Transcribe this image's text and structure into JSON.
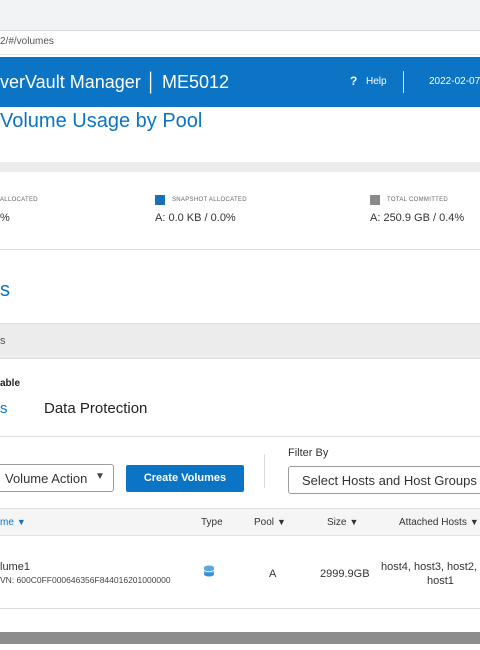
{
  "browser": {
    "url": "2/#/volumes"
  },
  "header": {
    "title": "verVault Manager │ ME5012",
    "help_glyph": "?",
    "help_label": "Help",
    "date": "2022-02-07"
  },
  "page_title": " Volume Usage by Pool",
  "stats": [
    {
      "label": "ALLOCATED",
      "value": "%",
      "color": ""
    },
    {
      "label": "SNAPSHOT ALLOCATED",
      "value": "A: 0.0 KB / 0.0%",
      "color": "#1a6fb8"
    },
    {
      "label": "TOTAL COMMITTED",
      "value": "A: 250.9 GB / 0.4%",
      "color": "#8a8a8a"
    }
  ],
  "section_title": "s",
  "table": {
    "label": "able",
    "tabs": [
      "s",
      "Data Protection"
    ]
  },
  "toolbar": {
    "action_label": "Volume Action",
    "create_label": "Create Volumes",
    "filter_by_label": "Filter By",
    "filter_placeholder": "Select Hosts and Host Groups"
  },
  "columns": {
    "name": "me",
    "type": "Type",
    "pool": "Pool",
    "size": "Size",
    "hosts": "Attached Hosts"
  },
  "rows": [
    {
      "name": "lume1",
      "wwn": "VN: 600C0FF000646356F844016201000000",
      "type_icon": "database-icon",
      "pool": "A",
      "size": "2999.9GB",
      "hosts_line1": "host4, host3, host2,",
      "hosts_line2": "host1"
    }
  ]
}
